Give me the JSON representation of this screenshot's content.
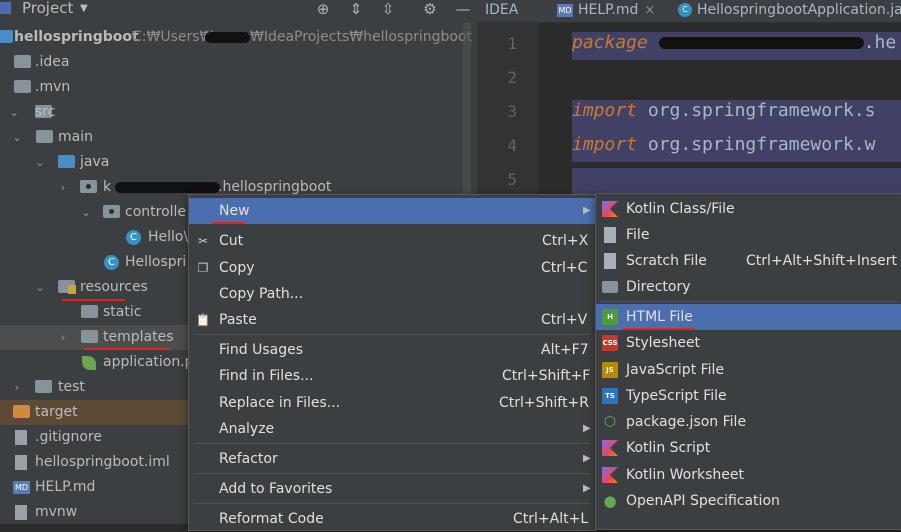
{
  "project": {
    "title": "Project",
    "root_name": "hellospringboot",
    "root_path": "C:₩Users₩",
    "root_path_tail": "₩IdeaProjects₩hellospringboot",
    "tree": {
      "idea": ".idea",
      "mvn": ".mvn",
      "src": "src",
      "main": "main",
      "java": "java",
      "pkg_prefix": "k",
      "pkg_suffix": ".hellospringboot",
      "controller": "controlle",
      "hello_class": "Hello\\",
      "app_class": "Hellospri",
      "resources": "resources",
      "static": "static",
      "templates": "templates",
      "app_props": "application.p",
      "test": "test",
      "target": "target",
      "gitignore": ".gitignore",
      "iml": "hellospringboot.iml",
      "help": "HELP.md",
      "mvnw": "mvnw"
    }
  },
  "editor": {
    "tabs": [
      {
        "label": "IDEA"
      },
      {
        "label": "HELP.md",
        "icon_text": "MD"
      },
      {
        "label": "HellospringbootApplication.ja",
        "icon_text": "C"
      }
    ],
    "line_numbers": [
      "1",
      "2",
      "3",
      "4",
      "5"
    ],
    "code": {
      "line1_kw": "package",
      "line1_tail": ".he",
      "line3_kw": "import",
      "line3_text": "org.springframework.s",
      "line4_kw": "import",
      "line4_text": "org.springframework.w"
    }
  },
  "context_menu": {
    "items": [
      {
        "label": "New",
        "shortcut": "",
        "submenu": true
      },
      {
        "label": "Cut",
        "shortcut": "Ctrl+X",
        "icon": "scissors-icon"
      },
      {
        "label": "Copy",
        "shortcut": "Ctrl+C",
        "icon": "copy-icon"
      },
      {
        "label": "Copy Path...",
        "shortcut": ""
      },
      {
        "label": "Paste",
        "shortcut": "Ctrl+V",
        "icon": "paste-icon"
      },
      {
        "label": "Find Usages",
        "shortcut": "Alt+F7"
      },
      {
        "label": "Find in Files...",
        "shortcut": "Ctrl+Shift+F"
      },
      {
        "label": "Replace in Files...",
        "shortcut": "Ctrl+Shift+R"
      },
      {
        "label": "Analyze",
        "shortcut": "",
        "submenu": true
      },
      {
        "label": "Refactor",
        "shortcut": "",
        "submenu": true
      },
      {
        "label": "Add to Favorites",
        "shortcut": "",
        "submenu": true
      },
      {
        "label": "Reformat Code",
        "shortcut": "Ctrl+Alt+L"
      }
    ]
  },
  "new_menu": {
    "items": [
      {
        "label": "Kotlin Class/File",
        "icon": "kotlin-icon"
      },
      {
        "label": "File",
        "icon": "file-icon"
      },
      {
        "label": "Scratch File",
        "shortcut": "Ctrl+Alt+Shift+Insert",
        "icon": "scratch-file-icon"
      },
      {
        "label": "Directory",
        "icon": "directory-icon"
      },
      {
        "label": "HTML File",
        "icon": "html-file-icon",
        "icon_text": "H"
      },
      {
        "label": "Stylesheet",
        "icon": "css-file-icon",
        "icon_text": "CSS"
      },
      {
        "label": "JavaScript File",
        "icon": "js-file-icon",
        "icon_text": "JS"
      },
      {
        "label": "TypeScript File",
        "icon": "ts-file-icon",
        "icon_text": "TS"
      },
      {
        "label": "package.json File",
        "icon": "nodejs-icon"
      },
      {
        "label": "Kotlin Script",
        "icon": "kotlin-script-icon"
      },
      {
        "label": "Kotlin Worksheet",
        "icon": "kotlin-worksheet-icon"
      },
      {
        "label": "OpenAPI Specification",
        "icon": "openapi-icon"
      }
    ]
  },
  "colors": {
    "panel_bg": "#3c3f41",
    "editor_bg": "#2b2b2b",
    "selection": "#4b6eaf",
    "keyword": "#cc7832",
    "annotation_red": "#e0241c"
  }
}
